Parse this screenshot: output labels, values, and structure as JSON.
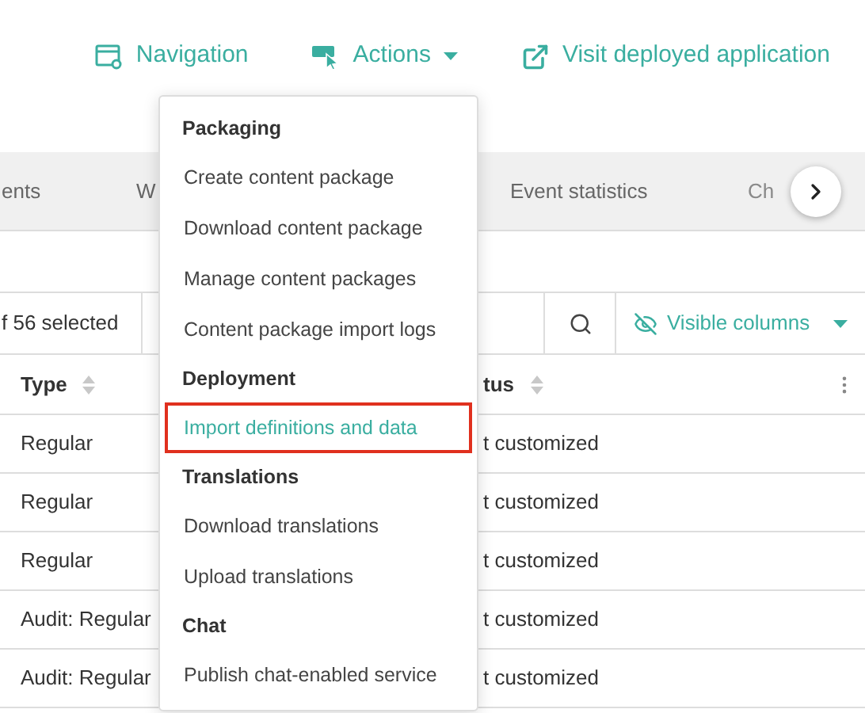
{
  "top_links": [
    {
      "kind": "navigation",
      "label": "Navigation"
    },
    {
      "kind": "actions",
      "label": "Actions"
    },
    {
      "kind": "external",
      "label": "Visit deployed application"
    }
  ],
  "tabs": [
    {
      "label": "ents"
    },
    {
      "label": "W"
    },
    {
      "label": "Event statistics"
    },
    {
      "label": "Ch"
    }
  ],
  "toolbar": {
    "selection": "f 56 selected",
    "columns_button": "Visible columns"
  },
  "table": {
    "columns": [
      "Type",
      "tus"
    ],
    "rows": [
      [
        "Regular",
        "t customized"
      ],
      [
        "Regular",
        "t customized"
      ],
      [
        "Regular",
        "t customized"
      ],
      [
        "Audit: Regular",
        "t customized"
      ],
      [
        "Audit: Regular",
        "t customized"
      ]
    ]
  },
  "menu": [
    {
      "kind": "header",
      "label": "Packaging"
    },
    {
      "kind": "item",
      "label": "Create content package",
      "highlighted": false
    },
    {
      "kind": "item",
      "label": "Download content package",
      "highlighted": false
    },
    {
      "kind": "item",
      "label": "Manage content packages",
      "highlighted": false
    },
    {
      "kind": "item",
      "label": "Content package import logs",
      "highlighted": false
    },
    {
      "kind": "header",
      "label": "Deployment"
    },
    {
      "kind": "item",
      "label": "Import definitions and data",
      "highlighted": true
    },
    {
      "kind": "header",
      "label": "Translations"
    },
    {
      "kind": "item",
      "label": "Download translations",
      "highlighted": false
    },
    {
      "kind": "item",
      "label": "Upload translations",
      "highlighted": false
    },
    {
      "kind": "header",
      "label": "Chat"
    },
    {
      "kind": "item",
      "label": "Publish chat-enabled service",
      "highlighted": false
    }
  ]
}
